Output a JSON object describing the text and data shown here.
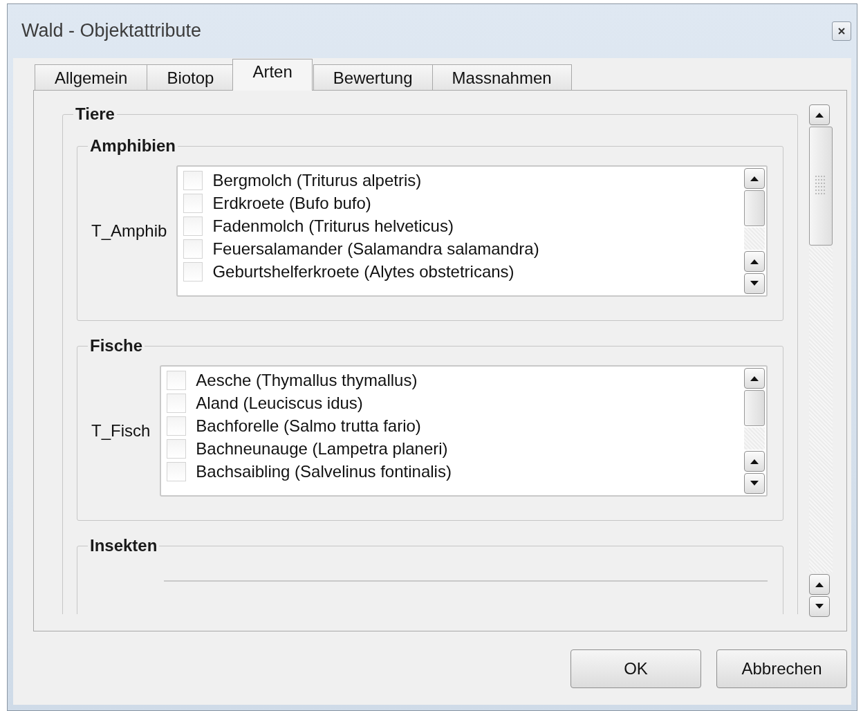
{
  "window": {
    "title": "Wald - Objektattribute"
  },
  "tabs": [
    {
      "label": "Allgemein",
      "selected": false
    },
    {
      "label": "Biotop",
      "selected": false
    },
    {
      "label": "Arten",
      "selected": true
    },
    {
      "label": "Bewertung",
      "selected": false
    },
    {
      "label": "Massnahmen",
      "selected": false
    }
  ],
  "groups": [
    {
      "title": "Tiere",
      "children": [
        {
          "title": "Amphibien",
          "field": {
            "label": "T_Amphib",
            "items": [
              {
                "label": "Bergmolch (Triturus alpetris)",
                "checked": false
              },
              {
                "label": "Erdkroete (Bufo bufo)",
                "checked": false
              },
              {
                "label": "Fadenmolch (Triturus helveticus)",
                "checked": false
              },
              {
                "label": "Feuersalamander (Salamandra salamandra)",
                "checked": false
              },
              {
                "label": "Geburtshelferkroete (Alytes obstetricans)",
                "checked": false
              }
            ]
          }
        },
        {
          "title": "Fische",
          "field": {
            "label": "T_Fisch",
            "items": [
              {
                "label": "Aesche (Thymallus thymallus)",
                "checked": false
              },
              {
                "label": "Aland (Leuciscus idus)",
                "checked": false
              },
              {
                "label": "Bachforelle (Salmo trutta fario)",
                "checked": false
              },
              {
                "label": "Bachneunauge (Lampetra planeri)",
                "checked": false
              },
              {
                "label": "Bachsaibling (Salvelinus fontinalis)",
                "checked": false
              }
            ]
          }
        },
        {
          "title": "Insekten"
        }
      ]
    }
  ],
  "buttons": [
    {
      "label": "OK"
    },
    {
      "label": "Abbrechen"
    }
  ]
}
